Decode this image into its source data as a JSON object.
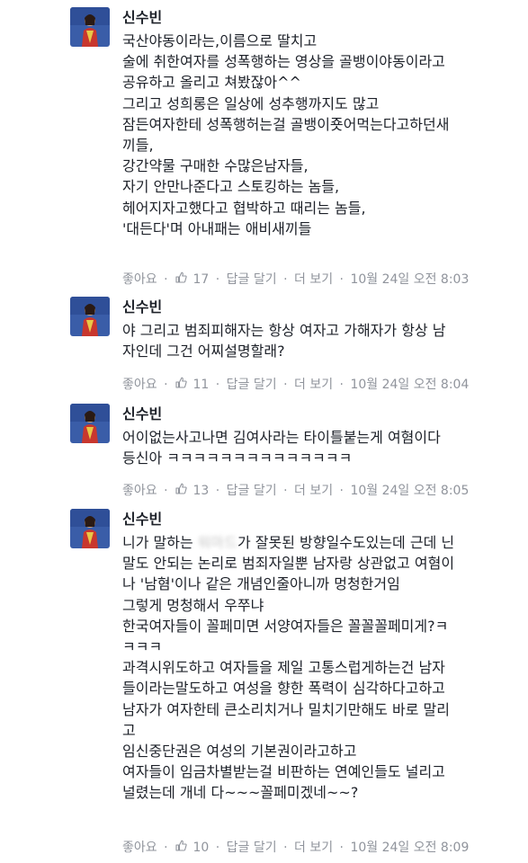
{
  "icons": {
    "like_count": "thumbs-up-icon",
    "avatar": "profile-photo"
  },
  "colors": {
    "name": "#1d2129",
    "meta": "#90949c",
    "link": "#4267b2"
  },
  "comments": [
    {
      "author": "신수빈",
      "lines": [
        "국산야동이라는,이름으로 딸치고",
        "술에 취한여자를 성폭행하는 영상을 골뱅이야동이라고",
        "공유하고 올리고 쳐봤잖아^^",
        "그리고 성희롱은 일상에 성추행까지도 많고",
        "잠든여자한테 성폭행허는걸 골뱅이죳어먹는다고하던새",
        "끼들,",
        "강간약물 구매한 수많은남자들,",
        "자기 안만나준다고 스토킹하는 놈들,",
        "헤어지자고했다고 협박하고 때리는 놈들,",
        "'대든다'며 아내패는 애비새끼들"
      ],
      "like_label": "좋아요",
      "like_count": "17",
      "reply_label": "답글 달기",
      "more_label": "더 보기",
      "timestamp": "10월 24일 오전 8:03"
    },
    {
      "author": "신수빈",
      "lines": [
        "야 그리고 범죄피해자는 항상 여자고 가해자가 항상 남",
        "자인데 그건 어찌설명할래?"
      ],
      "like_label": "좋아요",
      "like_count": "11",
      "reply_label": "답글 달기",
      "more_label": "더 보기",
      "timestamp": "10월 24일 오전 8:04"
    },
    {
      "author": "신수빈",
      "lines": [
        "어이없는사고나면 김여사라는 타이틀붙는게 여혐이다",
        "등신아 ㅋㅋㅋㅋㅋㅋㅋㅋㅋㅋㅋㅋㅋㅋ"
      ],
      "like_label": "좋아요",
      "like_count": "13",
      "reply_label": "답글 달기",
      "more_label": "더 보기",
      "timestamp": "10월 24일 오전 8:05"
    },
    {
      "author": "신수빈",
      "line1_pre": "니가 말하는 ",
      "line1_blur": "워마드",
      "line1_post": "가 잘못된 방향일수도있는데 근데 닌",
      "lines": [
        "말도 안되는 논리로 범죄자일뿐 남자랑 상관없고 여혐이",
        "나 '남혐'이나 같은 개념인줄아니까 멍청한거임",
        "그렇게 멍청해서 우쭈냐",
        "한국여자들이 꼴페미면 서양여자들은 꼴꼴꼴페미게?ㅋ",
        "ㅋㅋㅋ",
        "과격시위도하고 여자들을 제일 고통스럽게하는건 남자",
        "들이라는말도하고 여성을 향한 폭력이 심각하다고하고",
        "남자가 여자한테 큰소리치거나 밀치기만해도 바로 말리",
        "고",
        "임신중단권은 여성의 기본권이라고하고",
        "여자들이 임금차별받는걸 비판하는 연예인들도 널리고",
        "널렸는데 개네 다~~~꼴페미겠네~~?"
      ],
      "like_label": "좋아요",
      "like_count": "10",
      "reply_label": "답글 달기",
      "more_label": "더 보기",
      "timestamp": "10월 24일 오전 8:09"
    }
  ]
}
